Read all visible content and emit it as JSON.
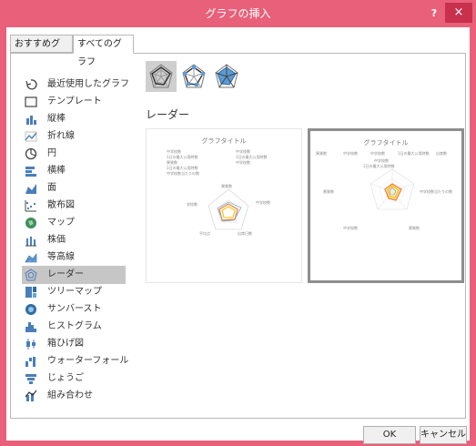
{
  "window": {
    "title": "グラフの挿入",
    "help": "?",
    "close": "×"
  },
  "tabs": [
    "おすすめグラフ",
    "すべてのグラフ"
  ],
  "sidebar": {
    "items": [
      {
        "label": "最近使用したグラフ",
        "icon": "recent-icon"
      },
      {
        "label": "テンプレート",
        "icon": "template-icon"
      },
      {
        "label": "縦棒",
        "icon": "column-chart-icon"
      },
      {
        "label": "折れ線",
        "icon": "line-chart-icon"
      },
      {
        "label": "円",
        "icon": "pie-chart-icon"
      },
      {
        "label": "横棒",
        "icon": "bar-chart-icon"
      },
      {
        "label": "面",
        "icon": "area-chart-icon"
      },
      {
        "label": "散布図",
        "icon": "scatter-chart-icon"
      },
      {
        "label": "マップ",
        "icon": "map-chart-icon"
      },
      {
        "label": "株価",
        "icon": "stock-chart-icon"
      },
      {
        "label": "等高線",
        "icon": "surface-chart-icon"
      },
      {
        "label": "レーダー",
        "icon": "radar-chart-icon"
      },
      {
        "label": "ツリーマップ",
        "icon": "treemap-chart-icon"
      },
      {
        "label": "サンバースト",
        "icon": "sunburst-chart-icon"
      },
      {
        "label": "ヒストグラム",
        "icon": "histogram-chart-icon"
      },
      {
        "label": "箱ひげ図",
        "icon": "box-whisker-chart-icon"
      },
      {
        "label": "ウォーターフォール",
        "icon": "waterfall-chart-icon"
      },
      {
        "label": "じょうご",
        "icon": "funnel-chart-icon"
      },
      {
        "label": "組み合わせ",
        "icon": "combo-chart-icon"
      }
    ],
    "selected": "レーダー"
  },
  "chart_type_name": "レーダー",
  "preview1": {
    "title": "グラフタイトル",
    "legend": [
      "中学校数",
      "中学校数",
      "1日の最大公用時数",
      "1日の最大公用時数",
      "異質数",
      "中学校数",
      "1日の最大公用時数",
      "中学校数当たりの数"
    ],
    "axis_labels": [
      "異質数",
      "中学校数",
      "出席日数",
      "平均点",
      "学校数"
    ]
  },
  "preview2": {
    "title": "グラフタイトル",
    "legend": [
      "異質数",
      "中学校数",
      "中学校数",
      "1日の最大公用時数",
      "出席数"
    ],
    "axis_labels": [
      "中学校数",
      "1日の最大公用時数",
      "異質数",
      "中学校数当たりの数",
      "中学校数",
      "異質数"
    ]
  },
  "buttons": {
    "ok": "OK",
    "cancel": "キャンセル"
  },
  "colors": {
    "accent": "#e8607a",
    "close": "#c8304e",
    "series_blue": "#5b9bd5",
    "series_orange": "#ed7d31",
    "series_gray": "#a5a5a5",
    "series_yellow": "#ffc000"
  }
}
